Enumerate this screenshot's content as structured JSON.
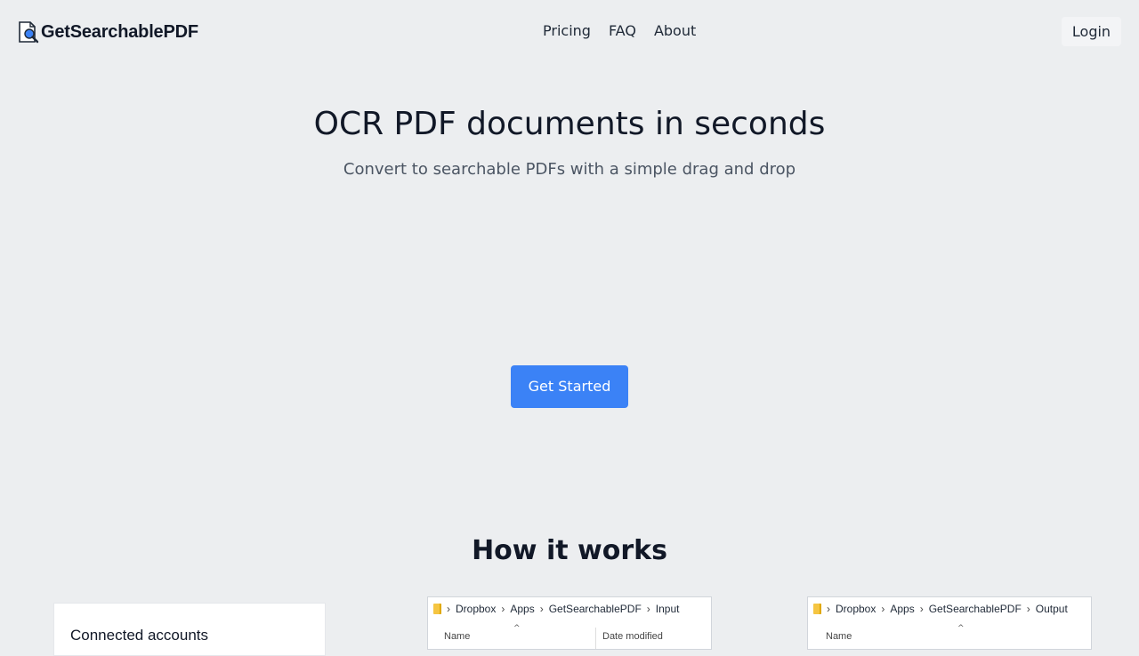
{
  "header": {
    "brand": "GetSearchablePDF",
    "nav": [
      "Pricing",
      "FAQ",
      "About"
    ],
    "login_label": "Login"
  },
  "hero": {
    "title": "OCR PDF documents in seconds",
    "subtitle": "Convert to searchable PDFs with a simple drag and drop",
    "cta_label": "Get Started"
  },
  "how": {
    "title": "How it works",
    "card1": {
      "heading": "Connected accounts"
    },
    "card2": {
      "breadcrumb": [
        "Dropbox",
        "Apps",
        "GetSearchablePDF",
        "Input"
      ],
      "col_name": "Name",
      "col_date": "Date modified"
    },
    "card3": {
      "breadcrumb": [
        "Dropbox",
        "Apps",
        "GetSearchablePDF",
        "Output"
      ],
      "col_name": "Name"
    }
  },
  "colors": {
    "background": "#eceef0",
    "accent": "#3b82f6"
  }
}
